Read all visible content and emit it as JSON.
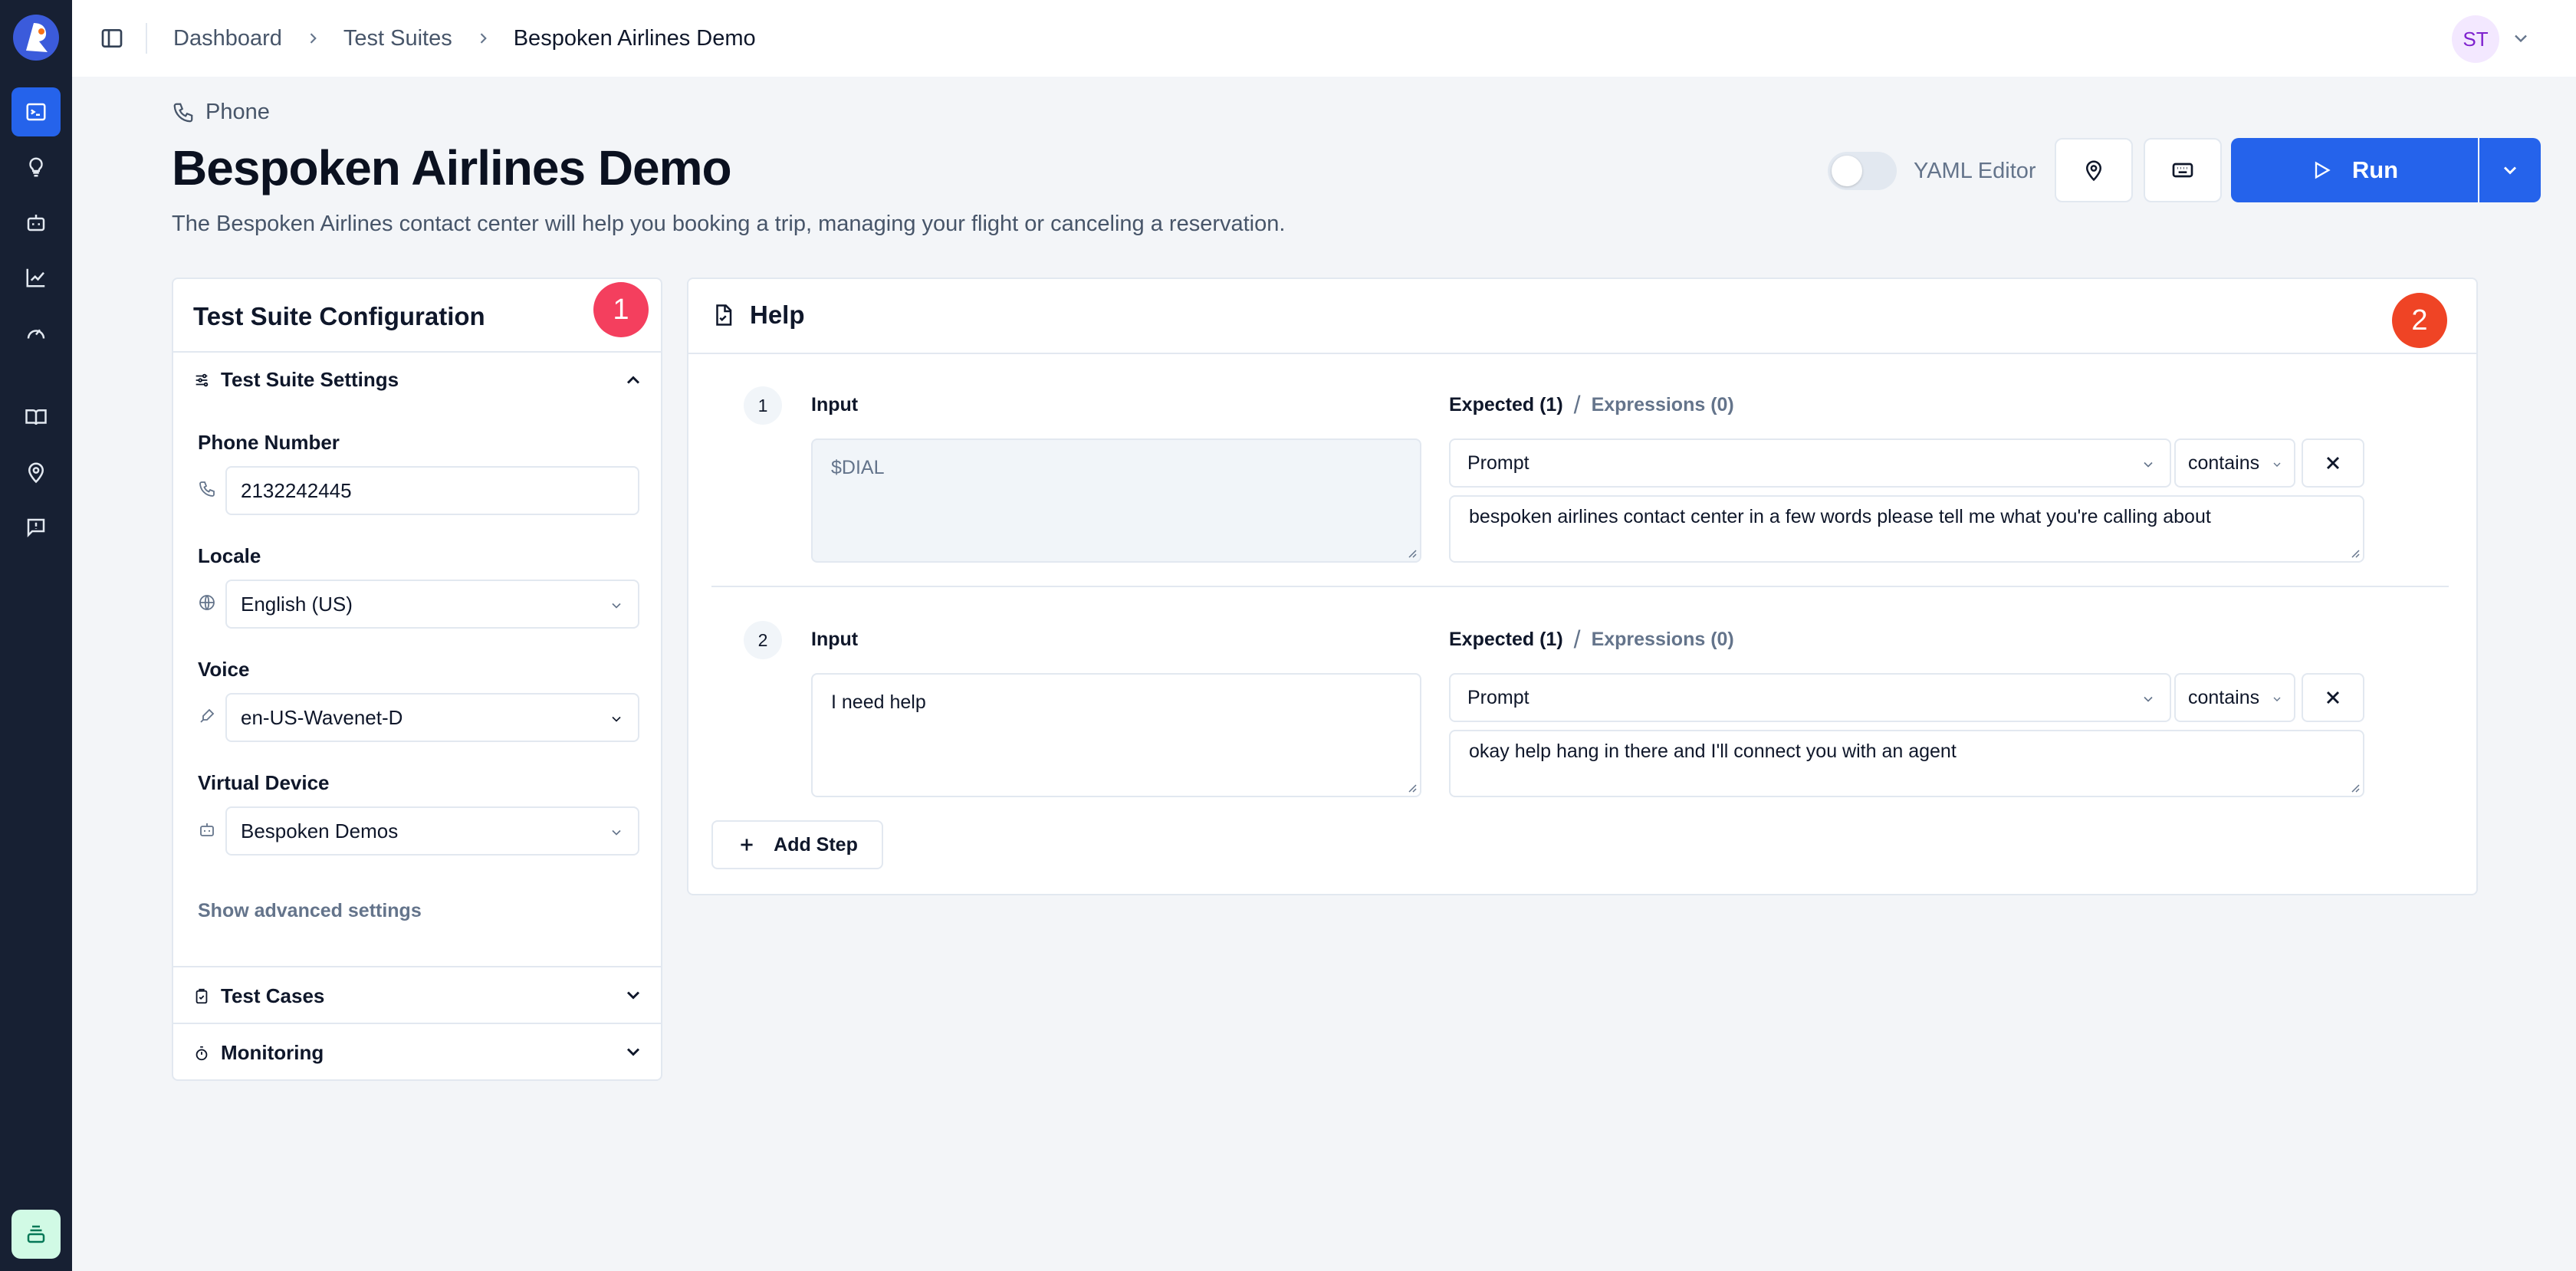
{
  "breadcrumb": [
    "Dashboard",
    "Test Suites",
    "Bespoken Airlines Demo"
  ],
  "user": {
    "initials": "ST"
  },
  "header": {
    "channel": "Phone",
    "title": "Bespoken Airlines Demo",
    "description": "The Bespoken Airlines contact center will help you booking a trip, managing your flight or canceling a reservation.",
    "yaml_editor_label": "YAML Editor",
    "yaml_editor_on": false,
    "run_label": "Run"
  },
  "config": {
    "title": "Test Suite Configuration",
    "badge": "1",
    "settings_label": "Test Suite Settings",
    "phone_label": "Phone Number",
    "phone_value": "2132242445",
    "locale_label": "Locale",
    "locale_value": "English (US)",
    "voice_label": "Voice",
    "voice_value": "en-US-Wavenet-D",
    "device_label": "Virtual Device",
    "device_value": "Bespoken Demos",
    "advanced_link": "Show advanced settings",
    "test_cases_label": "Test Cases",
    "monitoring_label": "Monitoring"
  },
  "help": {
    "title": "Help",
    "badge": "2",
    "add_step_label": "Add Step",
    "steps": [
      {
        "number": "1",
        "input_label": "Input",
        "input_value": "$DIAL",
        "expected_label": "Expected (1)",
        "separator": "/",
        "expressions_label": "Expressions (0)",
        "field": "Prompt",
        "operator": "contains",
        "expected_text": "bespoken airlines contact center in a few words please tell me what you're calling about"
      },
      {
        "number": "2",
        "input_label": "Input",
        "input_value": "I need help",
        "expected_label": "Expected (1)",
        "separator": "/",
        "expressions_label": "Expressions (0)",
        "field": "Prompt",
        "operator": "contains",
        "expected_text": "okay help hang in there and I'll connect you with an agent"
      }
    ]
  },
  "colors": {
    "primary": "#2563eb",
    "rail": "#172033",
    "badge1": "#f43f5e",
    "badge2": "#ef4425"
  }
}
